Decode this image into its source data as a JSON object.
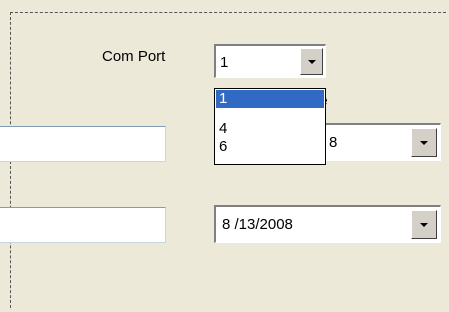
{
  "form": {
    "com_port_label": "Com Port",
    "com_port_value": "1",
    "com_port_options": [
      "1",
      "4",
      "6"
    ],
    "com_port_selected_index": 0,
    "partial_label_behind_popup": "te",
    "date1_partial_value": "8",
    "date2_value": "8 /13/2008",
    "text1_value": "",
    "text2_value": ""
  },
  "colors": {
    "selection": "#316ac5",
    "background": "#ece9d8"
  }
}
